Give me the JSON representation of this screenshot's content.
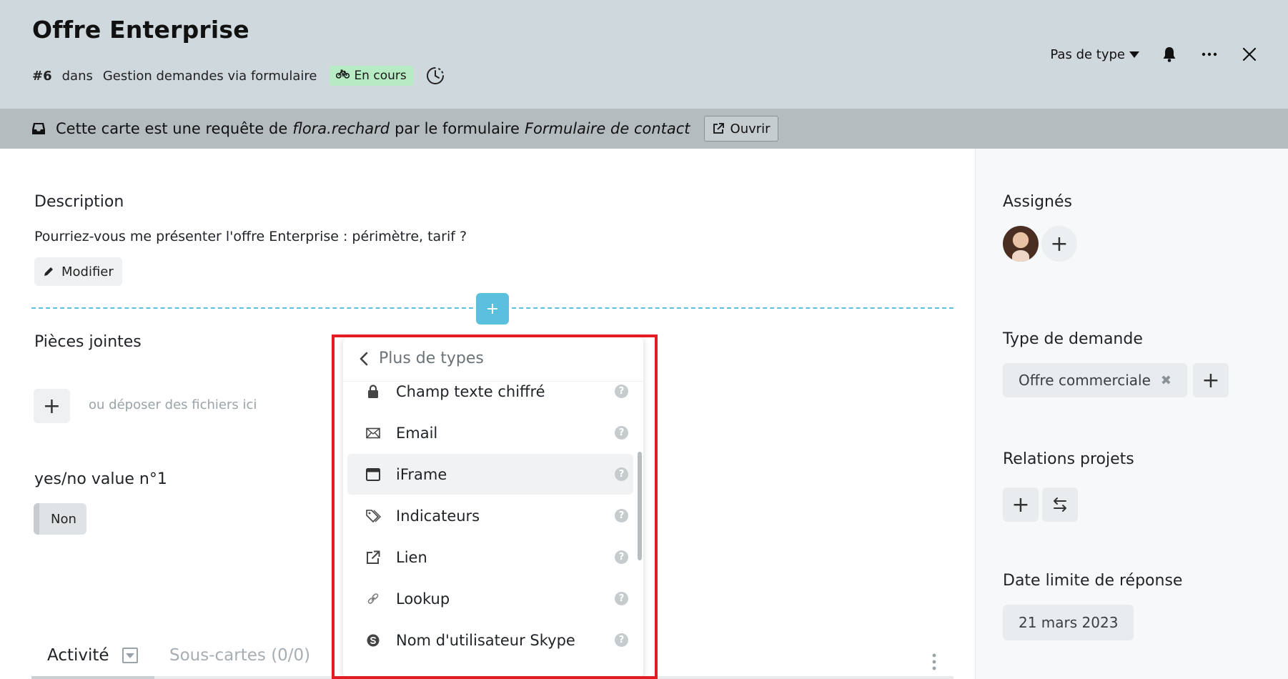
{
  "header": {
    "title": "Offre Enterprise",
    "card_number": "#6",
    "in_label": "dans",
    "board_name": "Gestion demandes via formulaire",
    "status": "En cours",
    "type_select": "Pas de type",
    "bg_color": "#cfd8dc"
  },
  "banner": {
    "prefix": "Cette carte est une requête de",
    "user": "flora.rechard",
    "middle": "par le formulaire",
    "form_name": "Formulaire de contact",
    "open_label": "Ouvrir"
  },
  "description": {
    "title": "Description",
    "text": "Pourriez-vous me présenter l'offre Enterprise : périmètre, tarif ?",
    "modify_label": "Modifier"
  },
  "add_field_label": "+",
  "attachments": {
    "title": "Pièces jointes",
    "drop_hint": "ou déposer des fichiers ici"
  },
  "yes_no": {
    "title": "yes/no value n°1",
    "value": "Non"
  },
  "tabs": {
    "activity": "Activité",
    "subcards": "Sous-cartes (0/0)"
  },
  "sidebar": {
    "assignees_title": "Assignés",
    "request_type_title": "Type de demande",
    "request_type_value": "Offre commerciale",
    "project_relations_title": "Relations projets",
    "deadline_title": "Date limite de réponse",
    "deadline_value": "21 mars 2023"
  },
  "dropdown": {
    "back_label": "Plus de types",
    "items": [
      {
        "label": "Champ texte chiffré",
        "icon": "lock-icon"
      },
      {
        "label": "Email",
        "icon": "envelope-icon"
      },
      {
        "label": "iFrame",
        "icon": "window-icon",
        "highlighted": true
      },
      {
        "label": "Indicateurs",
        "icon": "tags-icon"
      },
      {
        "label": "Lien",
        "icon": "external-link-icon"
      },
      {
        "label": "Lookup",
        "icon": "chain-link-icon"
      },
      {
        "label": "Nom d'utilisateur Skype",
        "icon": "skype-icon"
      }
    ],
    "help_glyph": "?"
  },
  "colors": {
    "accent": "#5bc0de",
    "status_bg": "#b7ebc3",
    "highlight_frame": "#e31b23"
  }
}
